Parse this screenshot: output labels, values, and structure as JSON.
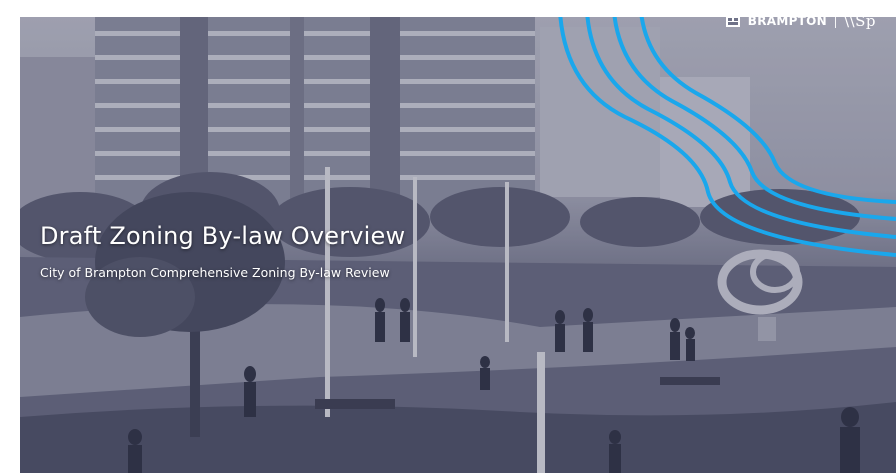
{
  "slide": {
    "title": "Draft Zoning By-law Overview",
    "subtitle": "City of Brampton Comprehensive Zoning By-law Review"
  },
  "logos": {
    "primary": "BRAMPTON",
    "separator": "|",
    "secondary": "\\\\Sp"
  },
  "icons": {
    "crest": "brampton-crest-icon"
  },
  "colors": {
    "accent_lines": "#1aa7ec",
    "photo_tint": "#5f6380",
    "text": "#ffffff"
  }
}
